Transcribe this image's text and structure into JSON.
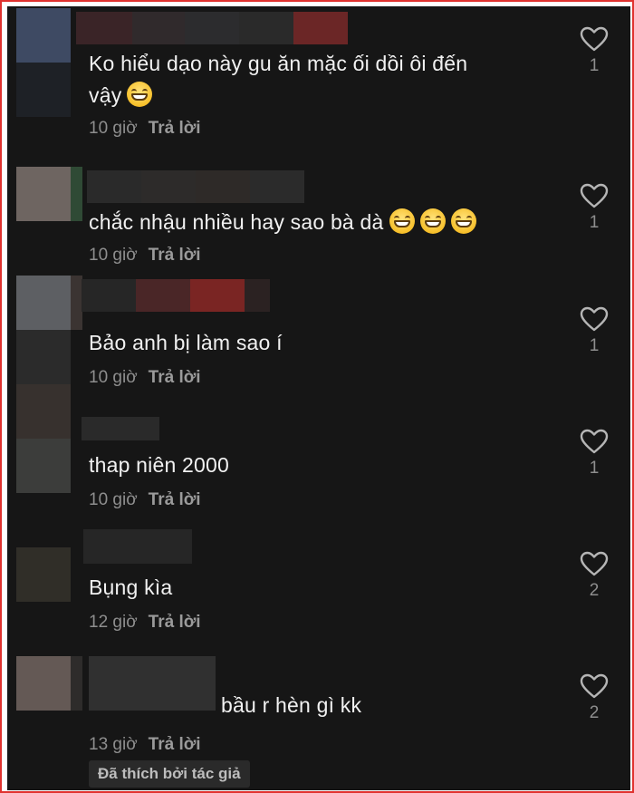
{
  "comments": [
    {
      "text": "Ko hiểu dạo này gu ăn mặc ối dồi ôi đến",
      "text2": "vậy",
      "emojis": 1,
      "time": "10 giờ",
      "reply": "Trả lời",
      "likes": "1"
    },
    {
      "text": "chắc nhậu nhiều hay sao bà dà",
      "emojis": 3,
      "time": "10 giờ",
      "reply": "Trả lời",
      "likes": "1"
    },
    {
      "text": "Bảo anh bị làm sao í",
      "time": "10 giờ",
      "reply": "Trả lời",
      "likes": "1"
    },
    {
      "text": "thap niên 2000",
      "time": "10 giờ",
      "reply": "Trả lời",
      "likes": "1"
    },
    {
      "text": "Bụng kìa",
      "time": "12 giờ",
      "reply": "Trả lời",
      "likes": "2"
    },
    {
      "text": "bầu r hèn gì kk",
      "time": "13 giờ",
      "reply": "Trả lời",
      "likes": "2",
      "liked_by_author": "Đã thích bởi tác giả"
    }
  ],
  "colors": {
    "background": "#161616",
    "frame": "#e0322f",
    "text": "#f1f1f1",
    "muted": "#8e8e8e"
  },
  "icons": {
    "like": "heart-outline-icon",
    "reaction": "grinning-face-emoji"
  }
}
